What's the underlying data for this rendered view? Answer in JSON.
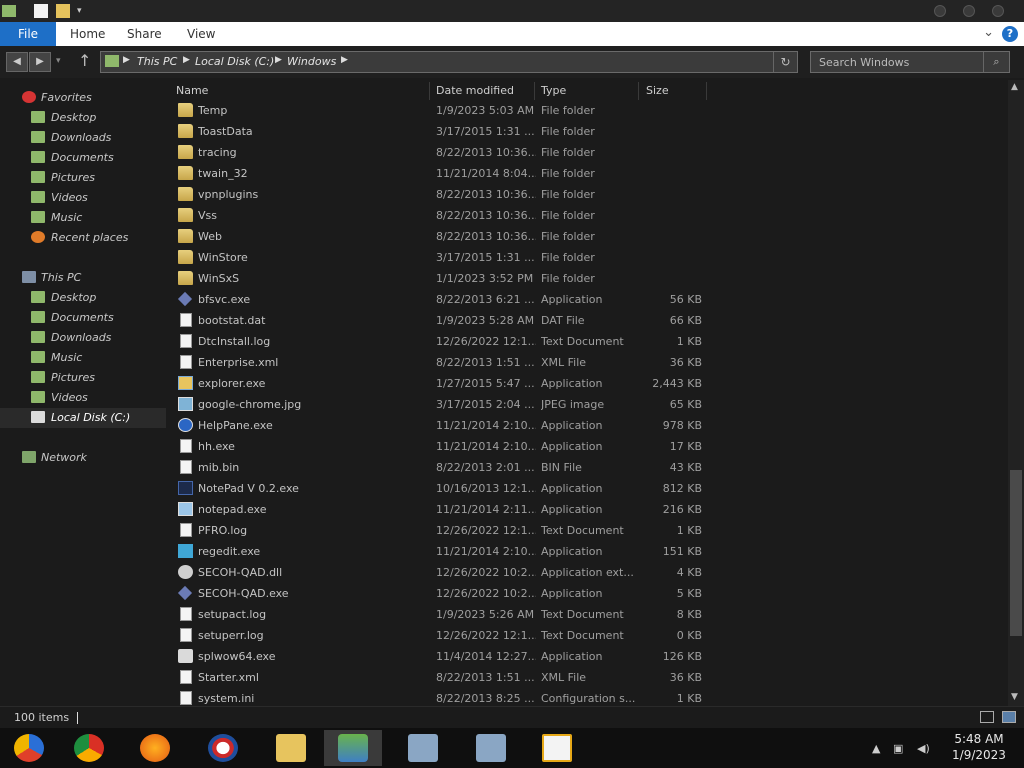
{
  "window": {
    "ribbon_tabs": [
      "File",
      "Home",
      "Share",
      "View"
    ],
    "help": "?"
  },
  "address": {
    "crumbs": [
      "This PC",
      "Local Disk (C:)",
      "Windows"
    ],
    "search_placeholder": "Search Windows"
  },
  "navpane": {
    "favorites": "Favorites",
    "fav_items": [
      "Desktop",
      "Downloads",
      "Documents",
      "Pictures",
      "Videos",
      "Music",
      "Recent places"
    ],
    "this_pc": "This PC",
    "pc_items": [
      "Desktop",
      "Documents",
      "Downloads",
      "Music",
      "Pictures",
      "Videos",
      "Local Disk (C:)"
    ],
    "network": "Network"
  },
  "columns": [
    "Name",
    "Date modified",
    "Type",
    "Size"
  ],
  "files": [
    {
      "name": "Temp",
      "date": "1/9/2023 5:03 AM",
      "type": "File folder",
      "size": "",
      "icon": "folder-icon"
    },
    {
      "name": "ToastData",
      "date": "3/17/2015 1:31 ...",
      "type": "File folder",
      "size": "",
      "icon": "folder-icon"
    },
    {
      "name": "tracing",
      "date": "8/22/2013 10:36...",
      "type": "File folder",
      "size": "",
      "icon": "folder-icon"
    },
    {
      "name": "twain_32",
      "date": "11/21/2014 8:04...",
      "type": "File folder",
      "size": "",
      "icon": "folder-icon"
    },
    {
      "name": "vpnplugins",
      "date": "8/22/2013 10:36...",
      "type": "File folder",
      "size": "",
      "icon": "folder-icon"
    },
    {
      "name": "Vss",
      "date": "8/22/2013 10:36...",
      "type": "File folder",
      "size": "",
      "icon": "folder-icon"
    },
    {
      "name": "Web",
      "date": "8/22/2013 10:36...",
      "type": "File folder",
      "size": "",
      "icon": "folder-icon"
    },
    {
      "name": "WinStore",
      "date": "3/17/2015 1:31 ...",
      "type": "File folder",
      "size": "",
      "icon": "folder-icon"
    },
    {
      "name": "WinSxS",
      "date": "1/1/2023 3:52 PM",
      "type": "File folder",
      "size": "",
      "icon": "folder-icon"
    },
    {
      "name": "bfsvc.exe",
      "date": "8/22/2013 6:21 ...",
      "type": "Application",
      "size": "56 KB",
      "icon": "app-icon"
    },
    {
      "name": "bootstat.dat",
      "date": "1/9/2023 5:28 AM",
      "type": "DAT File",
      "size": "66 KB",
      "icon": "file-icon"
    },
    {
      "name": "DtcInstall.log",
      "date": "12/26/2022 12:1...",
      "type": "Text Document",
      "size": "1 KB",
      "icon": "file-icon"
    },
    {
      "name": "Enterprise.xml",
      "date": "8/22/2013 1:51 ...",
      "type": "XML File",
      "size": "36 KB",
      "icon": "file-icon"
    },
    {
      "name": "explorer.exe",
      "date": "1/27/2015 5:47 ...",
      "type": "Application",
      "size": "2,443 KB",
      "icon": "explorer-icon"
    },
    {
      "name": "google-chrome.jpg",
      "date": "3/17/2015 2:04 ...",
      "type": "JPEG image",
      "size": "65 KB",
      "icon": "image-icon"
    },
    {
      "name": "HelpPane.exe",
      "date": "11/21/2014 2:10...",
      "type": "Application",
      "size": "978 KB",
      "icon": "help-icon"
    },
    {
      "name": "hh.exe",
      "date": "11/21/2014 2:10...",
      "type": "Application",
      "size": "17 KB",
      "icon": "help-file-icon"
    },
    {
      "name": "mib.bin",
      "date": "8/22/2013 2:01 ...",
      "type": "BIN File",
      "size": "43 KB",
      "icon": "file-icon"
    },
    {
      "name": "NotePad V 0.2.exe",
      "date": "10/16/2013 12:1...",
      "type": "Application",
      "size": "812 KB",
      "icon": "dark-app-icon"
    },
    {
      "name": "notepad.exe",
      "date": "11/21/2014 2:11...",
      "type": "Application",
      "size": "216 KB",
      "icon": "notepad-icon"
    },
    {
      "name": "PFRO.log",
      "date": "12/26/2022 12:1...",
      "type": "Text Document",
      "size": "1 KB",
      "icon": "file-icon"
    },
    {
      "name": "regedit.exe",
      "date": "11/21/2014 2:10...",
      "type": "Application",
      "size": "151 KB",
      "icon": "regedit-icon"
    },
    {
      "name": "SECOH-QAD.dll",
      "date": "12/26/2022 10:2...",
      "type": "Application ext...",
      "size": "4 KB",
      "icon": "gear-icon"
    },
    {
      "name": "SECOH-QAD.exe",
      "date": "12/26/2022 10:2...",
      "type": "Application",
      "size": "5 KB",
      "icon": "app-icon"
    },
    {
      "name": "setupact.log",
      "date": "1/9/2023 5:26 AM",
      "type": "Text Document",
      "size": "8 KB",
      "icon": "file-icon"
    },
    {
      "name": "setuperr.log",
      "date": "12/26/2022 12:1...",
      "type": "Text Document",
      "size": "0 KB",
      "icon": "file-icon"
    },
    {
      "name": "splwow64.exe",
      "date": "11/4/2014 12:27...",
      "type": "Application",
      "size": "126 KB",
      "icon": "printer-icon"
    },
    {
      "name": "Starter.xml",
      "date": "8/22/2013 1:51 ...",
      "type": "XML File",
      "size": "36 KB",
      "icon": "file-icon"
    },
    {
      "name": "system.ini",
      "date": "8/22/2013 8:25 ...",
      "type": "Configuration s...",
      "size": "1 KB",
      "icon": "config-icon"
    }
  ],
  "status": {
    "count": "100 items"
  },
  "clock": {
    "time": "5:48 AM",
    "date": "1/9/2023"
  },
  "colors": {
    "accent": "#1e6fc7",
    "background": "#1b1b1b",
    "folder": "#d9bd63"
  },
  "taskbar": [
    "chrome-alt-icon",
    "chrome-icon",
    "firefox-icon",
    "obama-logo-icon",
    "file-explorer-icon",
    "users-icon",
    "remote-desktop-icon",
    "remote-desktop-icon",
    "hxd-icon"
  ]
}
